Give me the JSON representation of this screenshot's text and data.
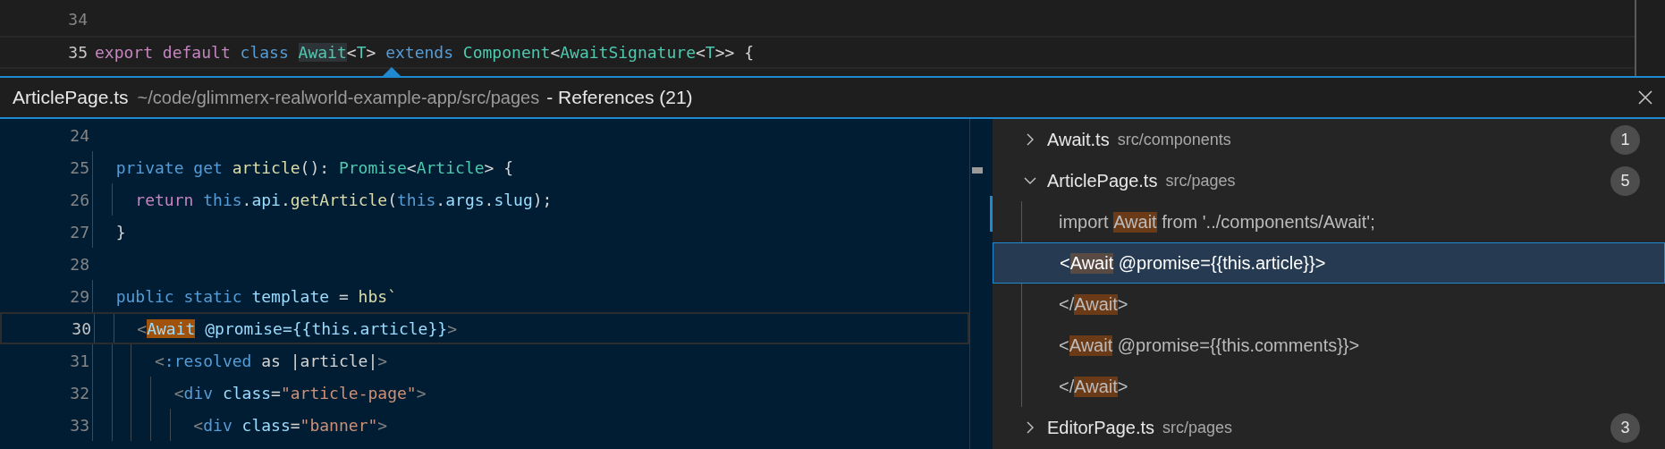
{
  "editor": {
    "lines": [
      {
        "number": "34",
        "current": false
      },
      {
        "number": "35",
        "current": true,
        "tokens": [
          {
            "text": "export default ",
            "kind": "kw"
          },
          {
            "text": "class ",
            "kind": "st"
          },
          {
            "text": "Await",
            "kind": "ref"
          },
          {
            "text": "<",
            "kind": "pu"
          },
          {
            "text": "T",
            "kind": "ty"
          },
          {
            "text": "> ",
            "kind": "pu"
          },
          {
            "text": "extends ",
            "kind": "st"
          },
          {
            "text": "Component",
            "kind": "ty"
          },
          {
            "text": "<",
            "kind": "pu"
          },
          {
            "text": "AwaitSignature",
            "kind": "ty"
          },
          {
            "text": "<",
            "kind": "pu"
          },
          {
            "text": "T",
            "kind": "ty"
          },
          {
            "text": ">> {",
            "kind": "pu"
          }
        ]
      }
    ]
  },
  "peek": {
    "file": "ArticlePage.ts",
    "path": "~/code/glimmerx-realworld-example-app/src/pages",
    "title": "- References (21)",
    "code": [
      {
        "number": "24",
        "current": false
      },
      {
        "number": "25",
        "current": false,
        "tokens": [
          {
            "text": "  private get ",
            "kind": "st"
          },
          {
            "text": "article",
            "kind": "fn"
          },
          {
            "text": "(): ",
            "kind": "pu"
          },
          {
            "text": "Promise",
            "kind": "ty"
          },
          {
            "text": "<",
            "kind": "pu"
          },
          {
            "text": "Article",
            "kind": "ty"
          },
          {
            "text": "> {",
            "kind": "pu"
          }
        ]
      },
      {
        "number": "26",
        "current": false,
        "tokens": [
          {
            "text": "    return ",
            "kind": "kw"
          },
          {
            "text": "this",
            "kind": "st"
          },
          {
            "text": ".",
            "kind": "pu"
          },
          {
            "text": "api",
            "kind": "va"
          },
          {
            "text": ".",
            "kind": "pu"
          },
          {
            "text": "getArticle",
            "kind": "fn"
          },
          {
            "text": "(",
            "kind": "pu"
          },
          {
            "text": "this",
            "kind": "st"
          },
          {
            "text": ".",
            "kind": "pu"
          },
          {
            "text": "args",
            "kind": "va"
          },
          {
            "text": ".",
            "kind": "pu"
          },
          {
            "text": "slug",
            "kind": "va"
          },
          {
            "text": ");",
            "kind": "pu"
          }
        ]
      },
      {
        "number": "27",
        "current": false,
        "tokens": [
          {
            "text": "  }",
            "kind": "pu"
          }
        ]
      },
      {
        "number": "28",
        "current": false
      },
      {
        "number": "29",
        "current": false,
        "tokens": [
          {
            "text": "  public static ",
            "kind": "st"
          },
          {
            "text": "template",
            "kind": "va"
          },
          {
            "text": " = ",
            "kind": "pu"
          },
          {
            "text": "hbs",
            "kind": "fn"
          },
          {
            "text": "`",
            "kind": "fn"
          }
        ]
      },
      {
        "number": "30",
        "current": true,
        "tokens": [
          {
            "text": "    <",
            "kind": "bracket"
          },
          {
            "text": "Await",
            "kind": "match"
          },
          {
            "text": " @promise={{this.article}}",
            "kind": "va"
          },
          {
            "text": ">",
            "kind": "bracket"
          }
        ]
      },
      {
        "number": "31",
        "current": false,
        "tokens": [
          {
            "text": "      <",
            "kind": "tag"
          },
          {
            "text": ":resolved",
            "kind": "st"
          },
          {
            "text": " as |article|",
            "kind": "pu"
          },
          {
            "text": ">",
            "kind": "tag"
          }
        ]
      },
      {
        "number": "32",
        "current": false,
        "tokens": [
          {
            "text": "        <",
            "kind": "tag"
          },
          {
            "text": "div",
            "kind": "st"
          },
          {
            "text": " class",
            "kind": "va"
          },
          {
            "text": "=",
            "kind": "pu"
          },
          {
            "text": "\"article-page\"",
            "kind": "str"
          },
          {
            "text": ">",
            "kind": "tag"
          }
        ]
      },
      {
        "number": "33",
        "current": false,
        "tokens": [
          {
            "text": "          <",
            "kind": "tag"
          },
          {
            "text": "div",
            "kind": "st"
          },
          {
            "text": " class",
            "kind": "va"
          },
          {
            "text": "=",
            "kind": "pu"
          },
          {
            "text": "\"banner\"",
            "kind": "str"
          },
          {
            "text": ">",
            "kind": "tag"
          }
        ]
      }
    ],
    "files": [
      {
        "name": "Await.ts",
        "path": "src/components",
        "count": "1",
        "expanded": false
      },
      {
        "name": "ArticlePage.ts",
        "path": "src/pages",
        "count": "5",
        "expanded": true,
        "refs": [
          {
            "selected": false,
            "parts": [
              {
                "text": "import ",
                "match": false
              },
              {
                "text": "Await",
                "match": true
              },
              {
                "text": " from '../components/Await';",
                "match": false
              }
            ]
          },
          {
            "selected": true,
            "parts": [
              {
                "text": "<",
                "match": false
              },
              {
                "text": "Await",
                "match": true
              },
              {
                "text": " @promise={{this.article}}>",
                "match": false
              }
            ]
          },
          {
            "selected": false,
            "parts": [
              {
                "text": "</",
                "match": false
              },
              {
                "text": "Await",
                "match": true
              },
              {
                "text": ">",
                "match": false
              }
            ]
          },
          {
            "selected": false,
            "parts": [
              {
                "text": "<",
                "match": false
              },
              {
                "text": "Await",
                "match": true
              },
              {
                "text": " @promise={{this.comments}}>",
                "match": false
              }
            ]
          },
          {
            "selected": false,
            "parts": [
              {
                "text": "</",
                "match": false
              },
              {
                "text": "Await",
                "match": true
              },
              {
                "text": ">",
                "match": false
              }
            ]
          }
        ]
      },
      {
        "name": "EditorPage.ts",
        "path": "src/pages",
        "count": "3",
        "expanded": false
      }
    ]
  }
}
